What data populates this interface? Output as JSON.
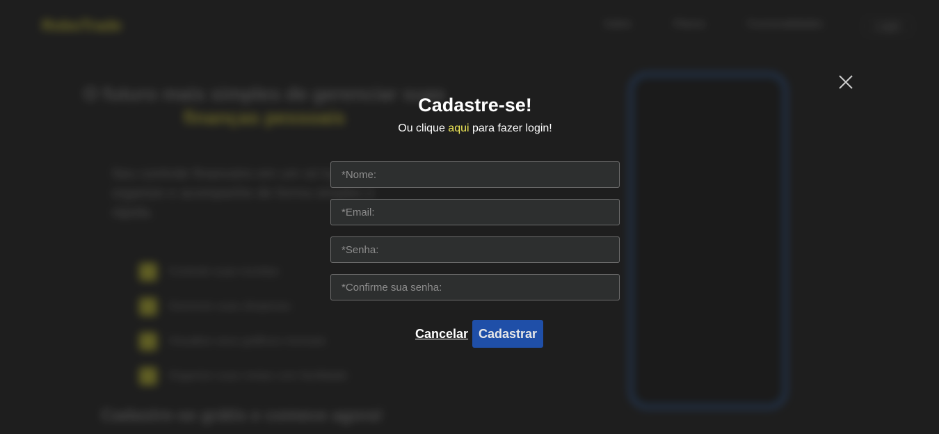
{
  "background": {
    "logo": "RoboTrade",
    "nav": [
      "Sobre",
      "Planos",
      "Funcionalidades",
      "Login"
    ],
    "hero_title": "O futuro mais simples de gerenciar suas",
    "hero_title_highlight": "finanças pessoais",
    "hero_text": "Seu controle financeiro em um só lugar: organize e acompanhe de forma simples e rápida.",
    "features": [
      "Controle suas receitas",
      "Gerencie suas despesas",
      "Visualize seus gráficos mensais",
      "Organize suas metas com facilidade"
    ],
    "cta": "Cadastre-se grátis e comece agora!"
  },
  "modal": {
    "title": "Cadastre-se!",
    "subtitle_before": "Ou clique",
    "subtitle_link": "aqui",
    "subtitle_after": "para fazer login!",
    "fields": {
      "name_placeholder": "*Nome:",
      "email_placeholder": "*Email:",
      "password_placeholder": "*Senha:",
      "confirm_placeholder": "*Confirme sua senha:"
    },
    "cancel_label": "Cancelar",
    "submit_label": "Cadastrar"
  },
  "colors": {
    "background": "#252525",
    "accent_link": "#f0e957",
    "primary_button": "#1f4fa8",
    "input_background": "#2d2f2f",
    "input_border": "#6d6d6d"
  },
  "icons": {
    "close": "close-icon"
  }
}
